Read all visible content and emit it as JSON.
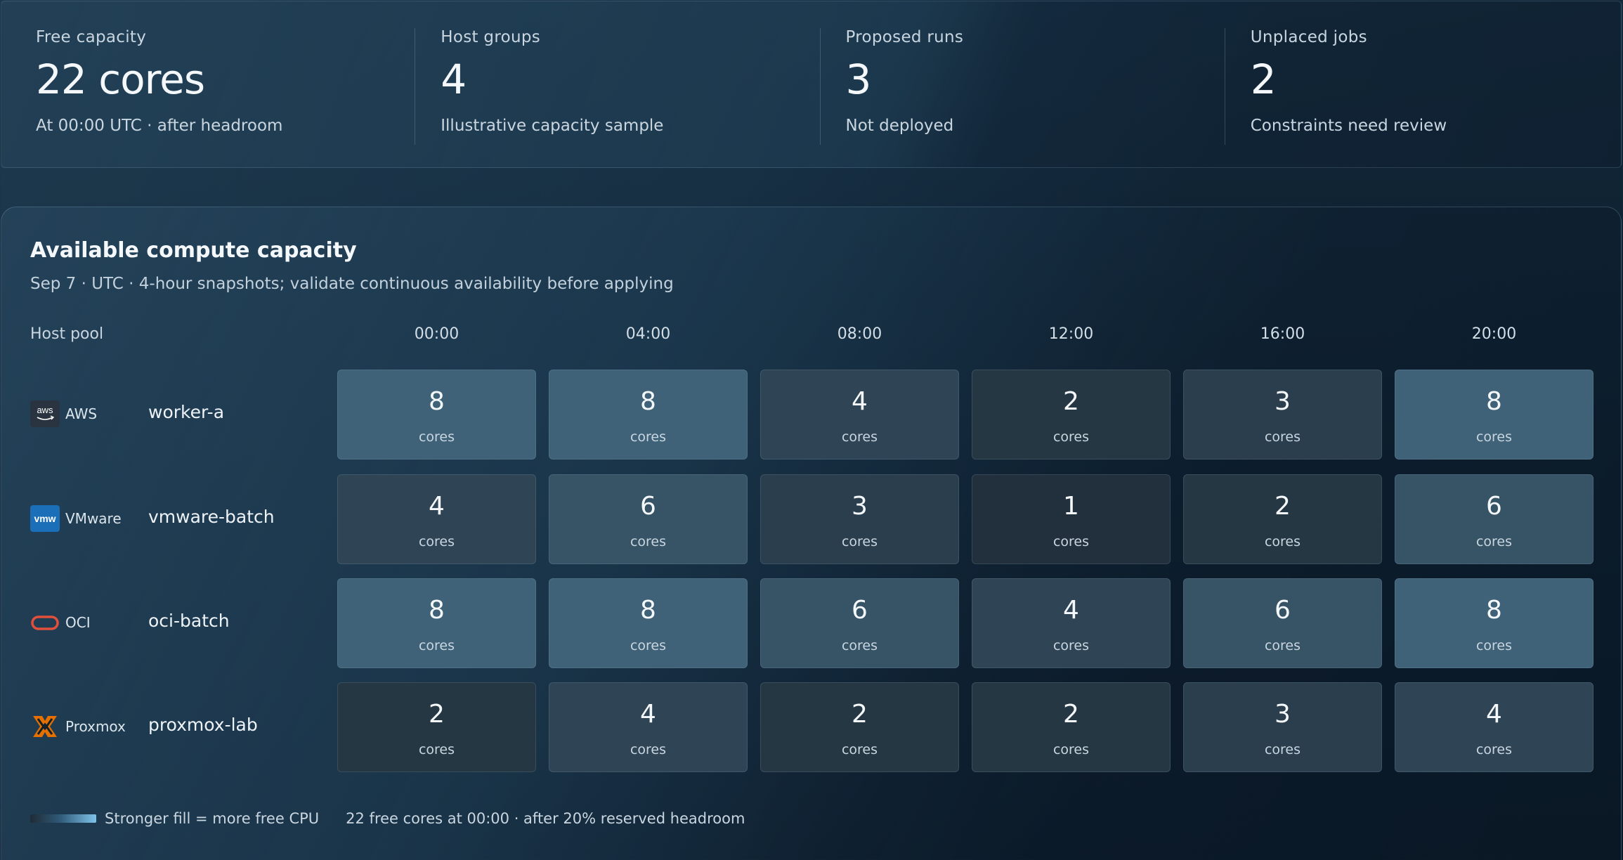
{
  "stats": [
    {
      "label": "Free capacity",
      "value": "22 cores",
      "sub": "At 00:00 UTC · after headroom"
    },
    {
      "label": "Host groups",
      "value": "4",
      "sub": "Illustrative capacity sample"
    },
    {
      "label": "Proposed runs",
      "value": "3",
      "sub": "Not deployed"
    },
    {
      "label": "Unplaced jobs",
      "value": "2",
      "sub": "Constraints need review"
    }
  ],
  "panel": {
    "title": "Available compute capacity",
    "subtitle": "Sep 7 · UTC · 4-hour snapshots; validate continuous availability before applying",
    "host_pool_label": "Host pool",
    "times": [
      "00:00",
      "04:00",
      "08:00",
      "12:00",
      "16:00",
      "20:00"
    ],
    "unit": "cores",
    "max_cores": 8,
    "rows": [
      {
        "provider": "AWS",
        "logo_text": "aws",
        "icon": "aws-logo-icon",
        "host": "worker-a",
        "cores": [
          8,
          8,
          4,
          2,
          3,
          8
        ]
      },
      {
        "provider": "VMware",
        "logo_text": "vmw",
        "icon": "vmware-logo-icon",
        "host": "vmware-batch",
        "cores": [
          4,
          6,
          3,
          1,
          2,
          6
        ]
      },
      {
        "provider": "OCI",
        "logo_text": "",
        "icon": "oracle-logo-icon",
        "host": "oci-batch",
        "cores": [
          8,
          8,
          6,
          4,
          6,
          8
        ]
      },
      {
        "provider": "Proxmox",
        "logo_text": "",
        "icon": "proxmox-logo-icon",
        "host": "proxmox-lab",
        "cores": [
          2,
          4,
          2,
          2,
          3,
          4
        ]
      }
    ],
    "legend": "Stronger fill = more free CPU",
    "note": "22 free cores at 00:00 · after 20% reserved headroom"
  },
  "colors": {
    "fill_low": "#1e2833",
    "fill_high": "#3f6278",
    "aws_logo_bg": "#2a3440",
    "vmware_logo_bg": "#1a6fb8",
    "oracle_logo": "#e0503c",
    "proxmox_logo": "#e57000"
  }
}
